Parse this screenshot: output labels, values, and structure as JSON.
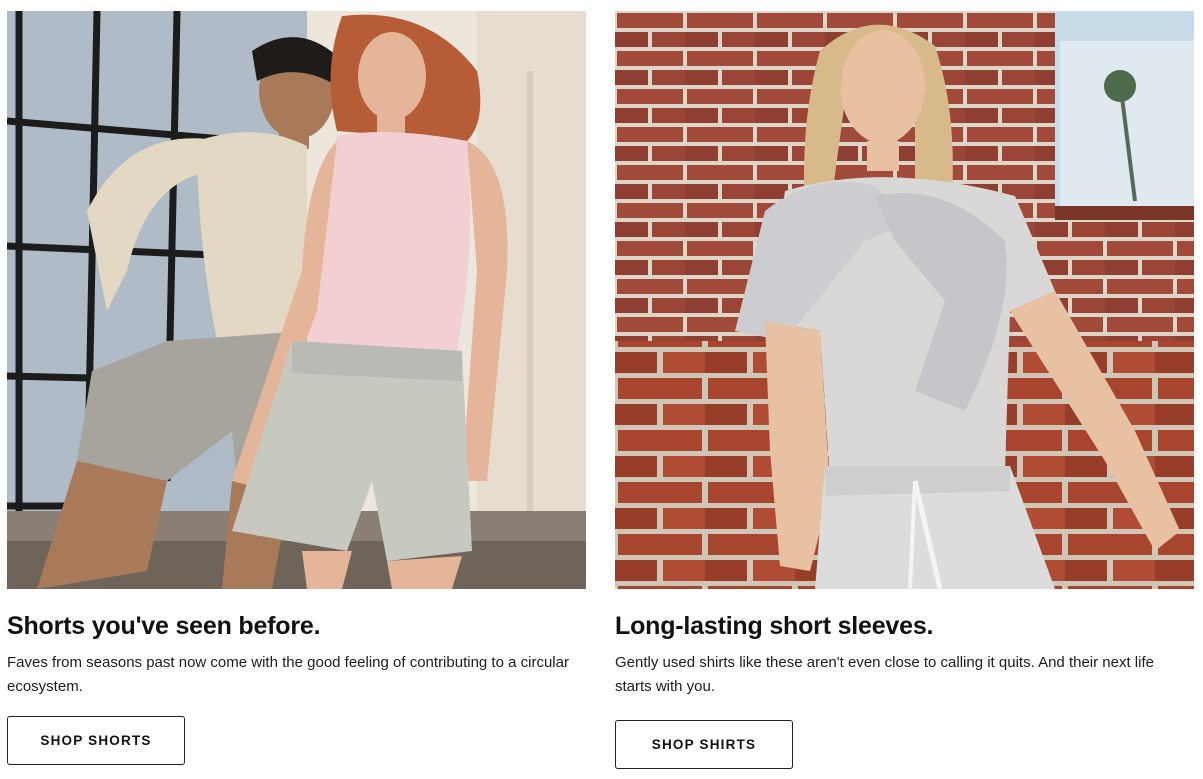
{
  "cards": [
    {
      "title": "Shorts you've seen before.",
      "description": "Faves from seasons past now come with the good feeling of contributing to a circular ecosystem.",
      "button_label": "SHOP SHORTS",
      "image": "two-models-shorts-photo"
    },
    {
      "title": "Long-lasting short sleeves.",
      "description": "Gently used shirts like these aren't even close to calling it quits. And their next life starts with you.",
      "button_label": "SHOP SHIRTS",
      "image": "model-brick-wall-shirt-photo"
    }
  ]
}
